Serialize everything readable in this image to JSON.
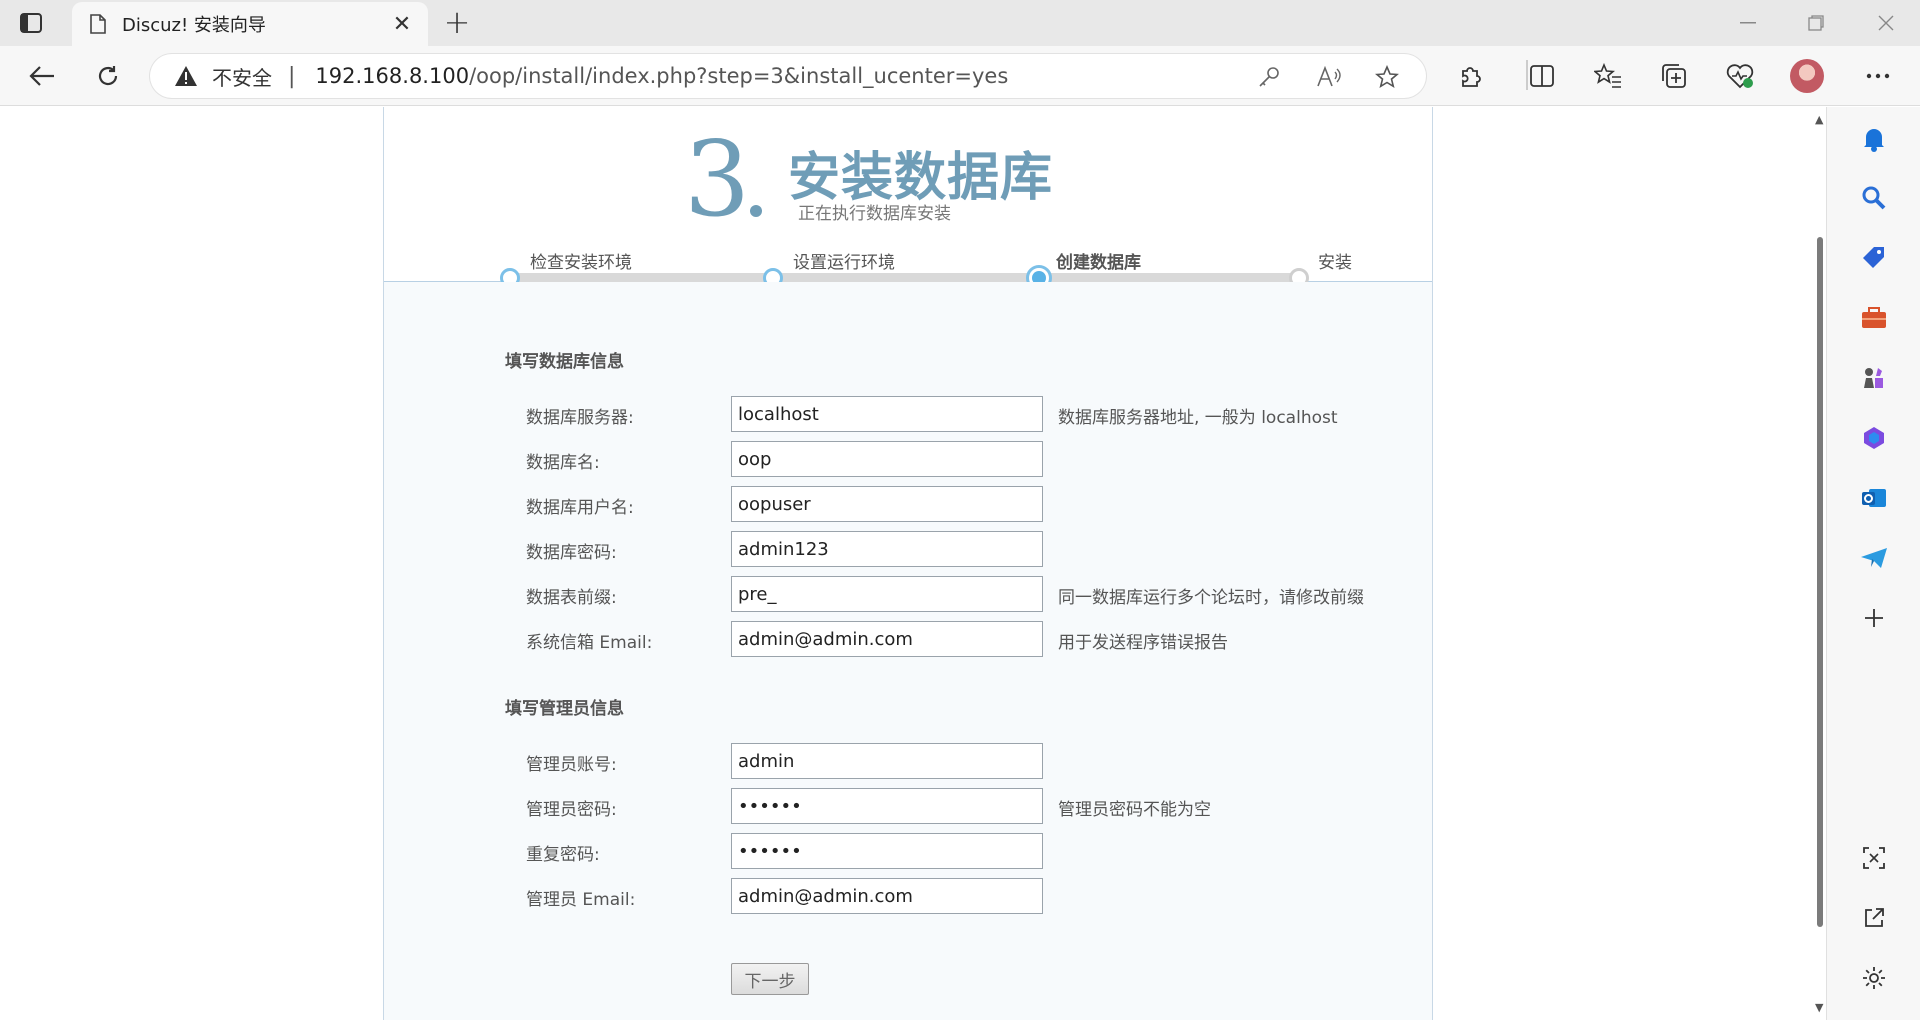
{
  "browser": {
    "tab_title": "Discuz! 安装向导",
    "tab_close": "✕",
    "new_tab": "+",
    "insecure_label": "不安全",
    "separator": "|",
    "url_host": "192.168.8.100",
    "url_rest": "/oop/install/index.php?step=3&install_ucenter=yes"
  },
  "header": {
    "step_number": "3",
    "title": "安装数据库",
    "subtitle": "正在执行数据库安装"
  },
  "steps": [
    {
      "label": "检查安装环境",
      "state": "done"
    },
    {
      "label": "设置运行环境",
      "state": "done"
    },
    {
      "label": "创建数据库",
      "state": "current"
    },
    {
      "label": "安装",
      "state": "future"
    }
  ],
  "db_section": {
    "title": "填写数据库信息",
    "fields": [
      {
        "label": "数据库服务器:",
        "value": "localhost",
        "hint": "数据库服务器地址, 一般为 localhost"
      },
      {
        "label": "数据库名:",
        "value": "oop",
        "hint": ""
      },
      {
        "label": "数据库用户名:",
        "value": "oopuser",
        "hint": ""
      },
      {
        "label": "数据库密码:",
        "value": "admin123",
        "hint": ""
      },
      {
        "label": "数据表前缀:",
        "value": "pre_",
        "hint": "同一数据库运行多个论坛时，请修改前缀"
      },
      {
        "label": "系统信箱 Email:",
        "value": "admin@admin.com",
        "hint": "用于发送程序错误报告"
      }
    ]
  },
  "admin_section": {
    "title": "填写管理员信息",
    "fields": [
      {
        "label": "管理员账号:",
        "value": "admin",
        "hint": ""
      },
      {
        "label": "管理员密码:",
        "value": "••••••",
        "hint": "管理员密码不能为空"
      },
      {
        "label": "重复密码:",
        "value": "••••••",
        "hint": ""
      },
      {
        "label": "管理员 Email:",
        "value": "admin@admin.com",
        "hint": ""
      }
    ]
  },
  "next_button": "下一步",
  "colors": {
    "accent": "#6f9db7",
    "progress_done": "#7cc0e8",
    "progress_current": "#59b2e6",
    "panel_bg": "#f7fafc"
  }
}
